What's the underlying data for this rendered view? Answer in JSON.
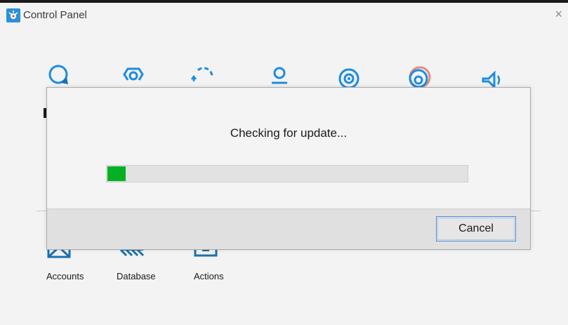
{
  "window": {
    "title": "Control Panel",
    "close_glyph": "×"
  },
  "top_icons": [
    "search-icon",
    "settings-icon",
    "sync-icon",
    "user-icon",
    "target-icon",
    "disc-icon",
    "volume-icon"
  ],
  "bottom_items": [
    {
      "label": "Accounts",
      "icon": "accounts-icon"
    },
    {
      "label": "Database",
      "icon": "database-icon"
    },
    {
      "label": "Actions",
      "icon": "actions-icon"
    }
  ],
  "dialog": {
    "message": "Checking for update...",
    "progress": 0.05,
    "cancel_label": "Cancel"
  },
  "colors": {
    "accent": "#1b8ce3",
    "progress_fill": "#06b025",
    "button_border": "#4a8fd9"
  }
}
